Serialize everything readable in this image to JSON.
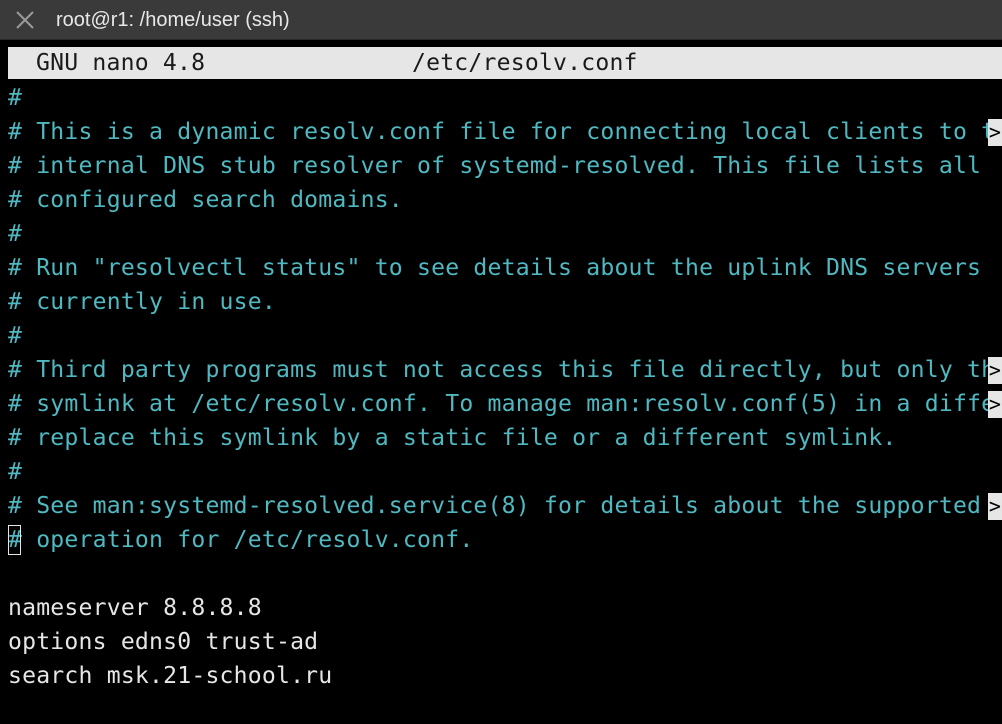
{
  "window": {
    "title": "root@r1: /home/user (ssh)"
  },
  "nano": {
    "version_label": "GNU nano 4.8",
    "file_name": "/etc/resolv.conf"
  },
  "file_lines": [
    {
      "text": "#",
      "comment": true,
      "truncated": false
    },
    {
      "text": "# This is a dynamic resolv.conf file for connecting local clients to t",
      "comment": true,
      "truncated": true
    },
    {
      "text": "# internal DNS stub resolver of systemd-resolved. This file lists all",
      "comment": true,
      "truncated": false
    },
    {
      "text": "# configured search domains.",
      "comment": true,
      "truncated": false
    },
    {
      "text": "#",
      "comment": true,
      "truncated": false
    },
    {
      "text": "# Run \"resolvectl status\" to see details about the uplink DNS servers",
      "comment": true,
      "truncated": false
    },
    {
      "text": "# currently in use.",
      "comment": true,
      "truncated": false
    },
    {
      "text": "#",
      "comment": true,
      "truncated": false
    },
    {
      "text": "# Third party programs must not access this file directly, but only th",
      "comment": true,
      "truncated": true
    },
    {
      "text": "# symlink at /etc/resolv.conf. To manage man:resolv.conf(5) in a diffe",
      "comment": true,
      "truncated": true
    },
    {
      "text": "# replace this symlink by a static file or a different symlink.",
      "comment": true,
      "truncated": false
    },
    {
      "text": "#",
      "comment": true,
      "truncated": false
    },
    {
      "text": "# See man:systemd-resolved.service(8) for details about the supported ",
      "comment": true,
      "truncated": true
    },
    {
      "text": "# operation for /etc/resolv.conf.",
      "comment": true,
      "truncated": false
    },
    {
      "text": "",
      "comment": false,
      "truncated": false
    },
    {
      "text": "nameserver 8.8.8.8",
      "comment": false,
      "truncated": false
    },
    {
      "text": "options edns0 trust-ad",
      "comment": false,
      "truncated": false
    },
    {
      "text": "search msk.21-school.ru",
      "comment": false,
      "truncated": false
    }
  ],
  "overflow_marker": ">",
  "cursor": {
    "line": 14,
    "column": 1
  },
  "colors": {
    "background": "#000000",
    "comment": "#4fb8c1",
    "plain_text": "#e6e6e6",
    "header_background": "#e6e6e6",
    "titlebar_background": "#3a3a3a"
  },
  "icons": {
    "close": "close-icon"
  }
}
